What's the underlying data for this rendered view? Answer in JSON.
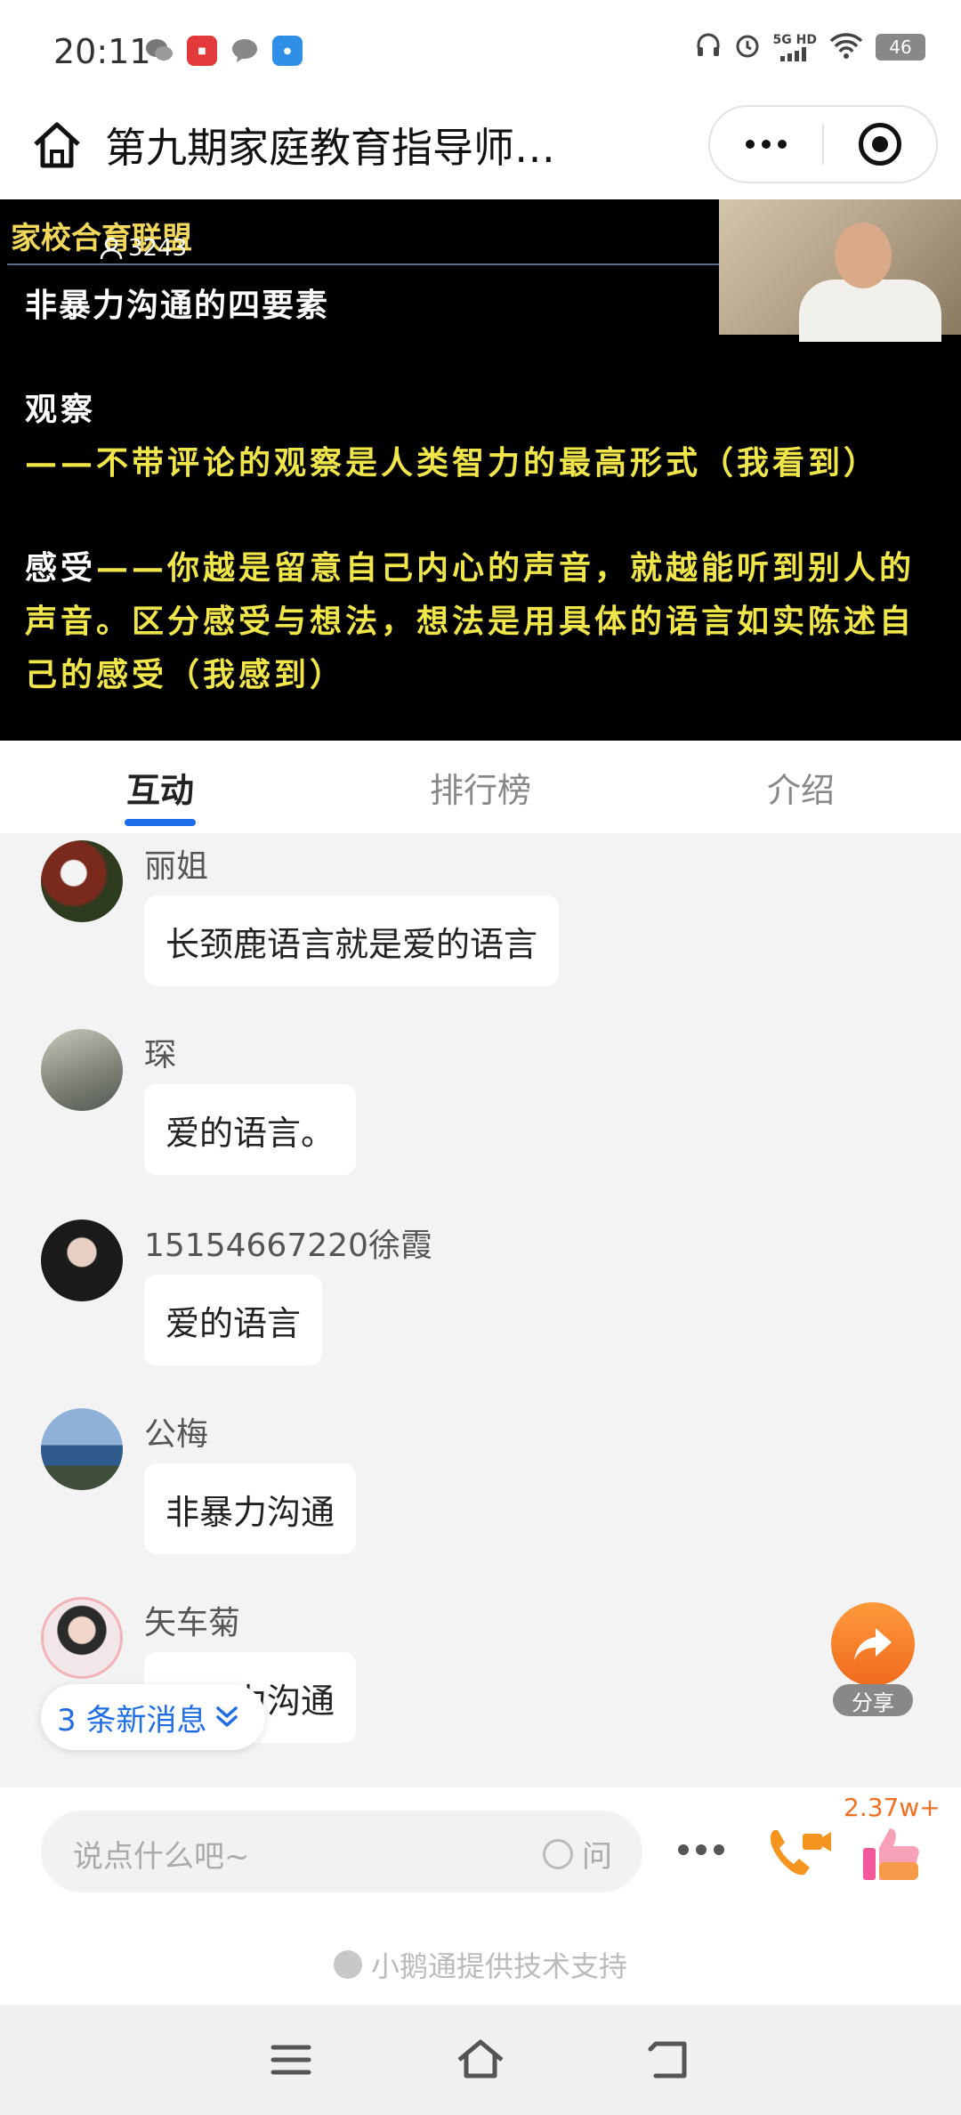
{
  "status_bar": {
    "time": "20:11",
    "network": "5G HD",
    "battery": "46",
    "icons": [
      "wechat-icon",
      "app-icon",
      "message-icon",
      "app-icon",
      "headphones-icon",
      "alarm-icon",
      "signal-icon",
      "wifi-icon",
      "battery-icon"
    ]
  },
  "header": {
    "title": "第九期家庭教育指导师…"
  },
  "video": {
    "logo": "家校合育联盟",
    "viewer_count": "3243",
    "slide_title": "非暴力沟通的四要素",
    "para1_label": "观察",
    "para1_text": "——不带评论的观察是人类智力的最高形式（我看到）",
    "para2_label": "感受",
    "para2_text": "——你越是留意自己内心的声音，就越能听到别人的声音。区分感受与想法，想法是用具体的语言如实陈述自己的感受（我感到）"
  },
  "tabs": [
    {
      "label": "互动",
      "active": true
    },
    {
      "label": "排行榜",
      "active": false
    },
    {
      "label": "介绍",
      "active": false
    }
  ],
  "messages": [
    {
      "name": "丽姐",
      "text": "长颈鹿语言就是爱的语言"
    },
    {
      "name": "琛",
      "text": "爱的语言。"
    },
    {
      "name": "15154667220徐霞",
      "text": "爱的语言"
    },
    {
      "name": "公梅",
      "text": "非暴力沟通"
    },
    {
      "name": "矢车菊",
      "text": "非暴力沟通"
    }
  ],
  "new_messages": "3 条新消息",
  "share_label": "分享",
  "input": {
    "placeholder": "说点什么吧~",
    "ask_label": "问",
    "like_count": "2.37w+"
  },
  "footer": {
    "powered_by": "小鹅通提供技术支持"
  },
  "colors": {
    "accent": "#1f6de6",
    "slide_text": "#f0e64a",
    "like": "#f07020"
  }
}
